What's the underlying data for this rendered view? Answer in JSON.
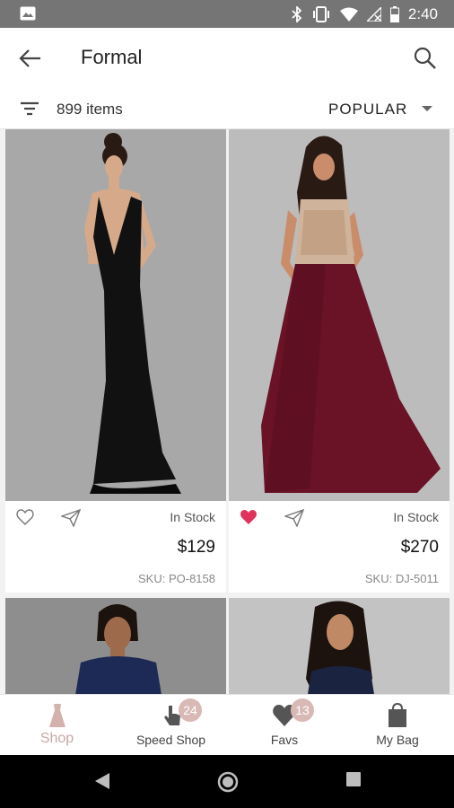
{
  "status_bar": {
    "time": "2:40"
  },
  "app_bar": {
    "title": "Formal"
  },
  "filter_bar": {
    "item_count": "899 items",
    "sort_label": "POPULAR"
  },
  "products": [
    {
      "stock": "In Stock",
      "price": "$129",
      "sku": "SKU: PO-8158",
      "favorited": false
    },
    {
      "stock": "In Stock",
      "price": "$270",
      "sku": "SKU: DJ-5011",
      "favorited": true
    }
  ],
  "bottom_nav": {
    "items": [
      {
        "label": "Shop",
        "active": true
      },
      {
        "label": "Speed Shop",
        "badge": "24"
      },
      {
        "label": "Favs",
        "badge": "13"
      },
      {
        "label": "My Bag"
      }
    ]
  },
  "colors": {
    "status_bar": "#757575",
    "accent_pink": "#d8b9b5",
    "heart_active": "#e0325a",
    "grid_bg": "#f2f2f2"
  }
}
